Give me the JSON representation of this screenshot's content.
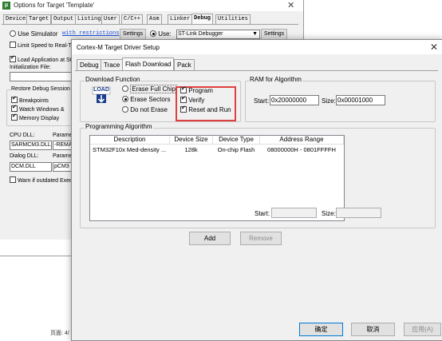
{
  "background_window": {
    "title": "Options for Target 'Template'",
    "tabs": [
      "Device",
      "Target",
      "Output",
      "Listing",
      "User",
      "C/C++",
      "Asm",
      "Linker",
      "Debug",
      "Utilities"
    ],
    "active_tab": "Debug",
    "use_simulator_label": "Use Simulator",
    "with_restrictions_link": "with restrictions",
    "settings_label": "Settings",
    "use_label": "Use:",
    "debugger_value": "ST-Link Debugger",
    "limit_speed_label": "Limit Speed to Real-Tir",
    "load_app_label": "Load Application at Sta",
    "init_file_label": "Initialization File:",
    "restore_group_label": "Restore Debug Session S",
    "breakpoints_label": "Breakpoints",
    "watch_windows_label": "Watch Windows &",
    "memory_display_label": "Memory Display",
    "cpu_dll_label": "CPU DLL:",
    "param_label": "Paramete",
    "cpu_dll_value": "SARMCM3.DLL",
    "cpu_param_value": "-REMA",
    "dialog_dll_label": "Dialog DLL:",
    "dialog_param_label": "Paramete",
    "dialog_dll_value": "DCM.DLL",
    "dialog_param_value": "pCM3",
    "warn_label": "Warn if outdated Execu",
    "page_label": "页面: 4/"
  },
  "dialog": {
    "title": "Cortex-M Target Driver Setup",
    "close_glyph": "✕",
    "tabs": [
      "Debug",
      "Trace",
      "Flash Download",
      "Pack"
    ],
    "active_tab": "Flash Download",
    "download_function": {
      "label": "Download Function",
      "load_icon_text": "LOAD",
      "erase_full_chip": "Erase Full Chip",
      "erase_sectors": "Erase Sectors",
      "do_not_erase": "Do not Erase",
      "selected_erase": "Erase Sectors",
      "program": "Program",
      "verify": "Verify",
      "reset_and_run": "Reset and Run",
      "program_checked": true,
      "verify_checked": true,
      "reset_checked": true
    },
    "ram_algorithm": {
      "label": "RAM for Algorithm",
      "start_label": "Start:",
      "start_value": "0x20000000",
      "size_label": "Size:",
      "size_value": "0x00001000"
    },
    "programming_algorithm": {
      "label": "Programming Algorithm",
      "columns": [
        "Description",
        "Device Size",
        "Device Type",
        "Address Range"
      ],
      "rows": [
        [
          "STM32F10x Med-density ...",
          "128k",
          "On-chip Flash",
          "08000000H - 0801FFFFH"
        ]
      ],
      "start_label": "Start:",
      "size_label": "Size:"
    },
    "add_label": "Add",
    "remove_label": "Remove",
    "ok_label": "确定",
    "cancel_label": "取消",
    "apply_label": "应用(A)"
  },
  "colors": {
    "highlight_box": "#e04040",
    "dialog_bg": "#f0f0f0"
  }
}
